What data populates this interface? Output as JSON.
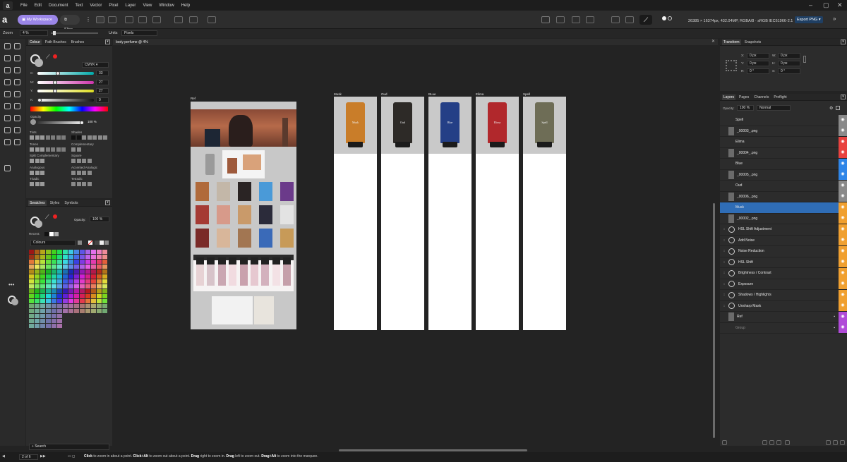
{
  "app": {
    "menu": [
      "File",
      "Edit",
      "Document",
      "Text",
      "Vector",
      "Pixel",
      "Layer",
      "View",
      "Window",
      "Help"
    ]
  },
  "toolbar": {
    "workspace_label": "My Workspace",
    "slice_label": "Slice",
    "doc_info": "26385 × 16374px, 432.04MP, RGBA/8 · sRGB IEC61966-2.1",
    "export_label": "Export PNG"
  },
  "context": {
    "zoom_label": "Zoom",
    "zoom_value": "4 %",
    "units_label": "Units",
    "units_value": "Pixels"
  },
  "left_panel": {
    "tabs": [
      "Colour",
      "Path Brushes",
      "Brushes"
    ],
    "color_mode": "CMYK",
    "channels": [
      {
        "label": "C:",
        "value": "33"
      },
      {
        "label": "M:",
        "value": "27"
      },
      {
        "label": "Y:",
        "value": "27"
      },
      {
        "label": "K:",
        "value": "0"
      }
    ],
    "opacity_label": "Opacity",
    "opacity_value": "100 %",
    "harmony": [
      {
        "left": "Tints",
        "right": "Shades"
      },
      {
        "left": "Tones",
        "right": "Complementary"
      },
      {
        "left": "Split Complementary",
        "right": "Square"
      },
      {
        "left": "Analogous",
        "right": "Accented Analogic"
      },
      {
        "left": "Triadic",
        "right": "Tetradic"
      }
    ],
    "swatch_tabs": [
      "Swatches",
      "Styles",
      "Symbols"
    ],
    "swatch_opacity_label": "Opacity:",
    "swatch_opacity_value": "100 %",
    "recent_label": "Recent:",
    "palette_name": "Colours",
    "search_placeholder": "Search"
  },
  "document": {
    "tab_title": "body perfume @ 4%",
    "ref_label": "Ref",
    "products": [
      {
        "label": "Musk",
        "name": "Musk",
        "color": "#c97d29"
      },
      {
        "label": "Oud",
        "name": "Oud",
        "color": "#2d2a27"
      },
      {
        "label": "BLue",
        "name": "Blue",
        "color": "#243f86"
      },
      {
        "label": "Elima",
        "name": "Elima",
        "color": "#b1282c"
      },
      {
        "label": "Spell",
        "name": "Spell",
        "color": "#6e6d56"
      }
    ]
  },
  "right_panel": {
    "transform_tabs": [
      "Transform",
      "Snapshots"
    ],
    "transform_fields": [
      {
        "label": "X:",
        "value": "0 px"
      },
      {
        "label": "W:",
        "value": "0 px"
      },
      {
        "label": "Y:",
        "value": "0 px"
      },
      {
        "label": "H:",
        "value": "0 px"
      },
      {
        "label": "R:",
        "value": "0 °"
      },
      {
        "label": "S:",
        "value": "0 °"
      }
    ],
    "layers_tabs": [
      "Layers",
      "Pages",
      "Channels",
      "Preflight"
    ],
    "layers_opacity_label": "Opacity:",
    "layers_opacity": "100 %",
    "blend_mode": "Normal",
    "layers": [
      {
        "name": "Spell",
        "kind": "group",
        "eye": "#8a8a8a"
      },
      {
        "name": "_00003_.png",
        "kind": "image",
        "eye": "#8a8a8a"
      },
      {
        "name": "Elima",
        "kind": "group",
        "eye": "#e8423f"
      },
      {
        "name": "_00004_.png",
        "kind": "image",
        "eye": "#e8423f"
      },
      {
        "name": "Blue",
        "kind": "group",
        "eye": "#2f86e8"
      },
      {
        "name": "_00005_.png",
        "kind": "image",
        "eye": "#2f86e8"
      },
      {
        "name": "Oud",
        "kind": "group",
        "eye": "#8a8a8a"
      },
      {
        "name": "_00006_.png",
        "kind": "image",
        "eye": "#8a8a8a"
      },
      {
        "name": "Musk",
        "kind": "group",
        "eye": "#f0a030",
        "selected": true
      },
      {
        "name": "_00002_.png",
        "kind": "image",
        "eye": "#f0a030"
      },
      {
        "name": "HSL Shift Adjustment",
        "kind": "fx",
        "eye": "#f0a030"
      },
      {
        "name": "Add Noise",
        "kind": "fx",
        "eye": "#f0a030"
      },
      {
        "name": "Noise Reduction",
        "kind": "fx",
        "eye": "#f0a030"
      },
      {
        "name": "HSL Shift",
        "kind": "fx",
        "eye": "#f0a030"
      },
      {
        "name": "Brightness / Contrast",
        "kind": "fx",
        "eye": "#f0a030"
      },
      {
        "name": "Exposure",
        "kind": "fx",
        "eye": "#f0a030"
      },
      {
        "name": "Shadows / Highlights",
        "kind": "fx",
        "eye": "#f0a030"
      },
      {
        "name": "Unsharp Mask",
        "kind": "fx",
        "eye": "#f0a030"
      },
      {
        "name": "Ref",
        "kind": "image",
        "eye": "#b04ad8"
      },
      {
        "name": "Group",
        "kind": "group",
        "eye": "#b04ad8",
        "dim": true
      }
    ]
  },
  "status": {
    "page": "2 of 6",
    "hint_parts": [
      "Click",
      " to zoom in about a point. ",
      "Click+Alt",
      " to zoom out about a point. ",
      "Drag",
      " right to zoom in. ",
      "Drag",
      " left to zoom out. ",
      "Drag+Alt",
      " to zoom into the marquee."
    ]
  }
}
